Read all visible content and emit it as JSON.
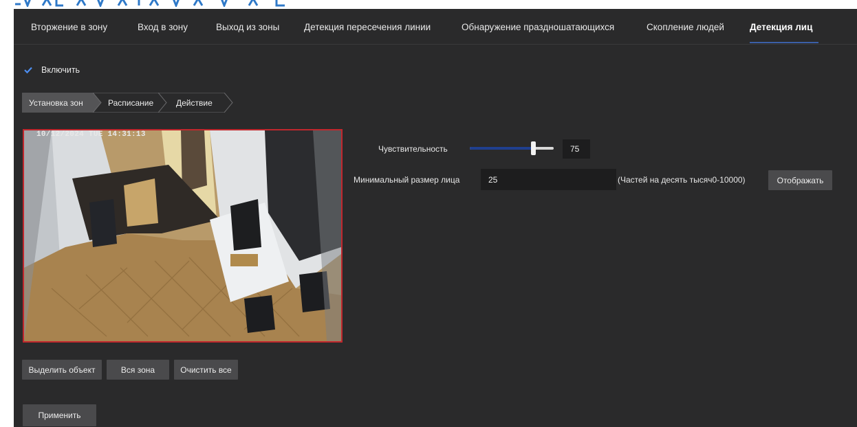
{
  "tabs": [
    {
      "label": "Вторжение в зону",
      "active": false
    },
    {
      "label": "Вход в зону",
      "active": false
    },
    {
      "label": "Выход из зоны",
      "active": false
    },
    {
      "label": "Детекция пересечения линии",
      "active": false
    },
    {
      "label": "Обнаружение праздношатающихся",
      "active": false
    },
    {
      "label": "Скопление людей",
      "active": false
    },
    {
      "label": "Детекция лиц",
      "active": true
    }
  ],
  "enable": {
    "label": "Включить",
    "checked": true
  },
  "steps": [
    {
      "label": "Установка зон",
      "active": true
    },
    {
      "label": "Расписание",
      "active": false
    },
    {
      "label": "Действие",
      "active": false
    }
  ],
  "video": {
    "timestamp": "10/12/2024 TUE 14:31:13"
  },
  "zone_buttons": {
    "select_object": "Выделить объект",
    "full_zone": "Вся зона",
    "clear_all": "Очистить все"
  },
  "apply_label": "Применить",
  "sensitivity": {
    "label": "Чувствительность",
    "value": "75",
    "fraction": 0.75
  },
  "min_face": {
    "label": "Минимальный размер лица",
    "value": "25",
    "hint": "(Частей на десять тысяч0-10000)",
    "display_label": "Отображать"
  },
  "colors": {
    "accent": "#3b5fa8",
    "zone_border": "#c1272d",
    "background": "#2a2a2b"
  }
}
